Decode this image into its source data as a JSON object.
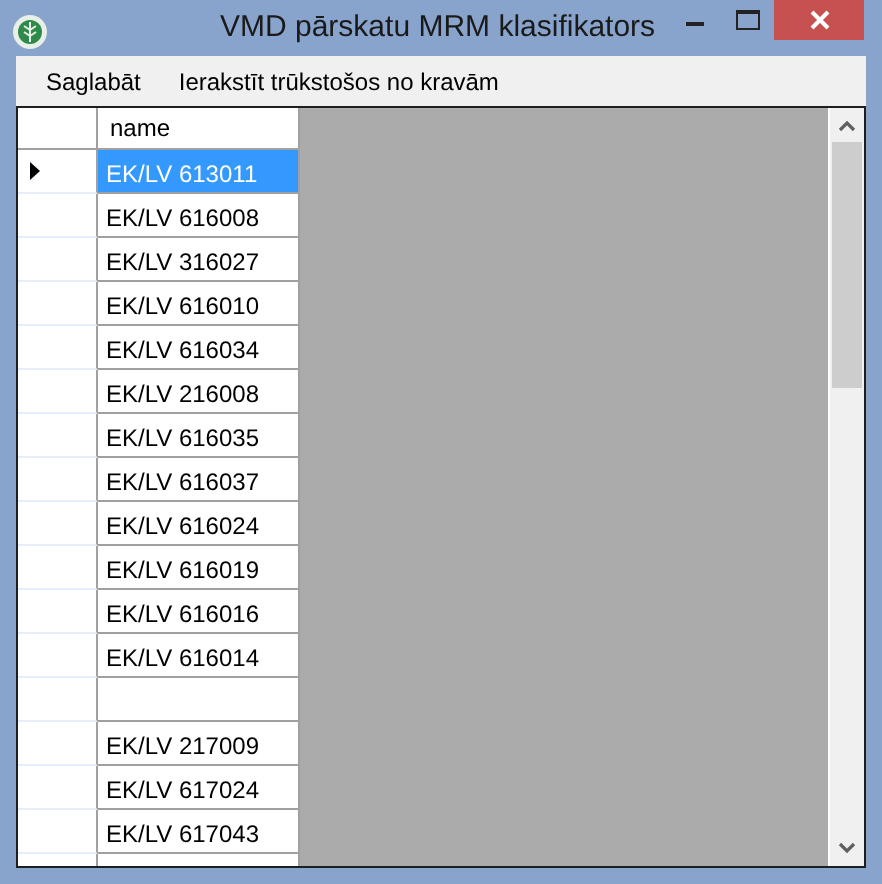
{
  "window": {
    "title": "VMD pārskatu MRM klasifikators"
  },
  "menu": [
    {
      "label": "Saglabāt"
    },
    {
      "label": "Ierakstīt trūkstošos no kravām"
    }
  ],
  "table": {
    "columns": [
      "name"
    ],
    "rows": [
      {
        "name": "EK/LV 613011",
        "selected": true
      },
      {
        "name": "EK/LV 616008",
        "selected": false
      },
      {
        "name": "EK/LV 316027",
        "selected": false
      },
      {
        "name": "EK/LV 616010",
        "selected": false
      },
      {
        "name": "EK/LV 616034",
        "selected": false
      },
      {
        "name": "EK/LV 216008",
        "selected": false
      },
      {
        "name": "EK/LV 616035",
        "selected": false
      },
      {
        "name": "EK/LV 616037",
        "selected": false
      },
      {
        "name": "EK/LV 616024",
        "selected": false
      },
      {
        "name": "EK/LV 616019",
        "selected": false
      },
      {
        "name": "EK/LV 616016",
        "selected": false
      },
      {
        "name": "EK/LV 616014",
        "selected": false
      },
      {
        "selected": false
      },
      {
        "name": "EK/LV 217009",
        "selected": false
      },
      {
        "name": "EK/LV 617024",
        "selected": false
      },
      {
        "name": "EK/LV 617043",
        "selected": false
      },
      {
        "selected": false
      }
    ]
  }
}
